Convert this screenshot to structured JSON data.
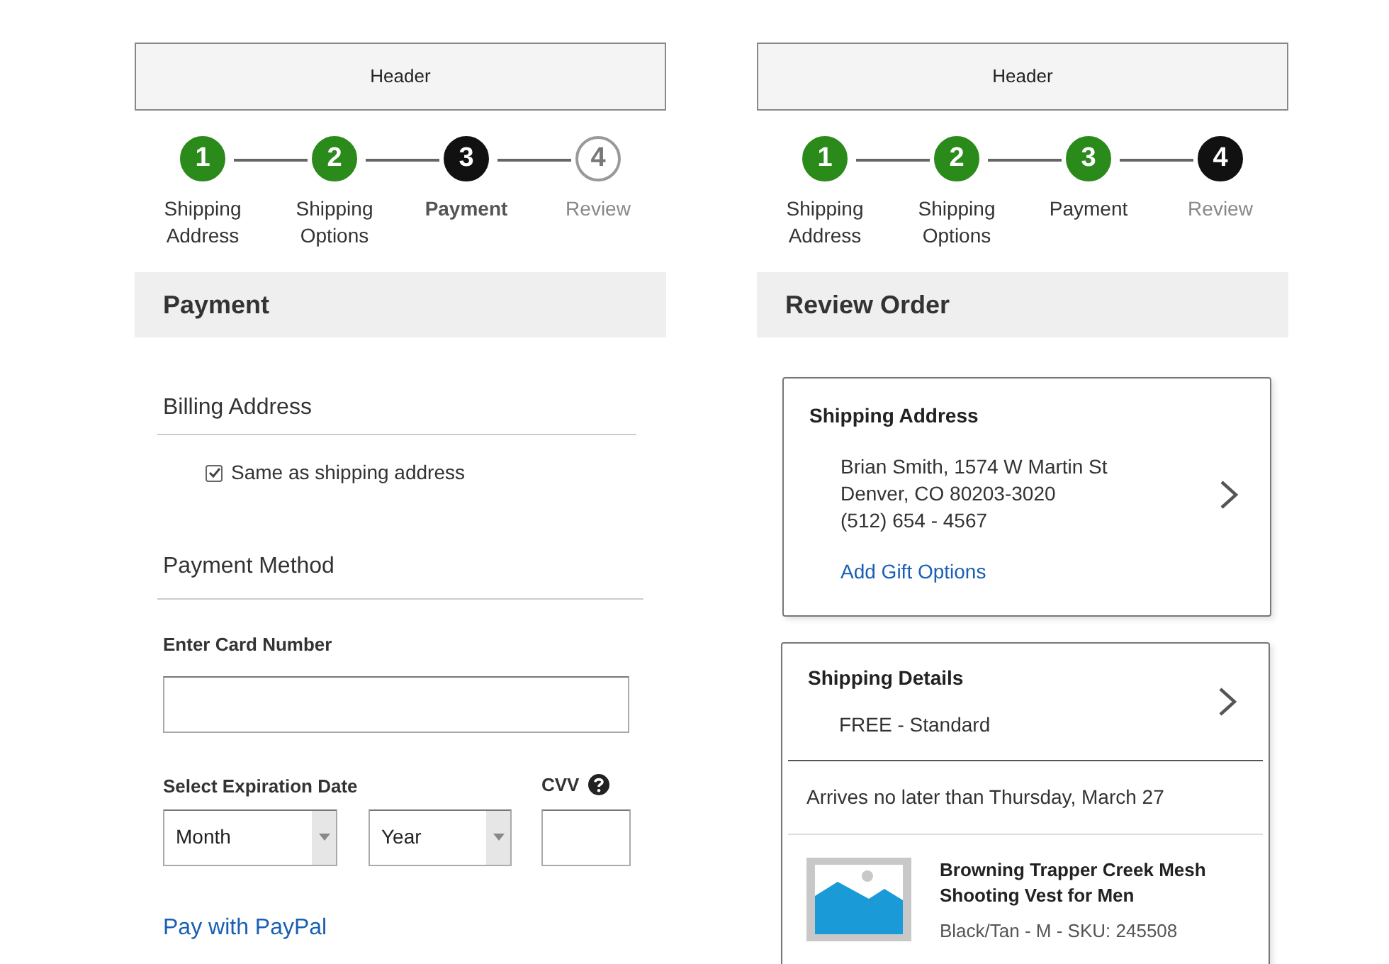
{
  "payment_screen": {
    "header": "Header",
    "steps": [
      {
        "number": "1",
        "label": "Shipping Address",
        "completed": true,
        "current": false,
        "emphasized": false
      },
      {
        "number": "2",
        "label": "Shipping Options",
        "completed": true,
        "current": false,
        "emphasized": false
      },
      {
        "number": "3",
        "label": "Payment",
        "completed": false,
        "current": true,
        "emphasized": true
      },
      {
        "number": "4",
        "label": "Review",
        "completed": false,
        "current": false,
        "emphasized": false
      }
    ],
    "title": "Payment",
    "billing_heading": "Billing Address",
    "same_as_shipping": {
      "label": "Same as shipping address",
      "checked": true
    },
    "method_heading": "Payment Method",
    "card_number_label": "Enter Card Number",
    "expiration_label": "Select Expiration Date",
    "month_select": "Month",
    "year_select": "Year",
    "cvv_label": "CVV",
    "paypal_link": "Pay with PayPal"
  },
  "review_screen": {
    "header": "Header",
    "steps": [
      {
        "number": "1",
        "label": "Shipping Address",
        "completed": true,
        "current": false,
        "emphasized": false
      },
      {
        "number": "2",
        "label": "Shipping Options",
        "completed": true,
        "current": false,
        "emphasized": false
      },
      {
        "number": "3",
        "label": "Payment",
        "completed": true,
        "current": false,
        "emphasized": false
      },
      {
        "number": "4",
        "label": "Review",
        "completed": false,
        "current": true,
        "emphasized": false
      }
    ],
    "title": "Review Order",
    "shipping_address": {
      "heading": "Shipping Address",
      "lines": [
        "Brian Smith, 1574 W Martin St",
        "Denver, CO 80203-3020",
        "(512) 654 - 4567"
      ],
      "link": "Add Gift Options"
    },
    "shipping_details": {
      "heading": "Shipping Details",
      "method": "FREE - Standard",
      "arrival": "Arrives no later than Thursday, March 27",
      "item": {
        "name": "Browning Trapper Creek Mesh Shooting Vest for Men",
        "variant": "Black/Tan - M - SKU: 245508"
      }
    }
  }
}
